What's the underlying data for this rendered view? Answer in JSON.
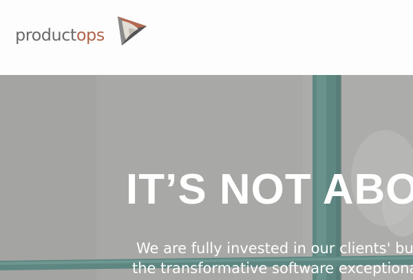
{
  "header": {
    "logo": {
      "product_text": "product",
      "ops_text": "ops",
      "brand_colors": {
        "grey": "#6b6b6b",
        "rust": "#b0644c"
      },
      "icon": "triangle-logo-mark-icon"
    }
  },
  "hero": {
    "title": "IT’S NOT ABOU",
    "subtitle_line1": "We are fully invested in our clients' bus",
    "subtitle_line2": "the transformative software exceptiona",
    "background_color": "#a9a9a7"
  }
}
